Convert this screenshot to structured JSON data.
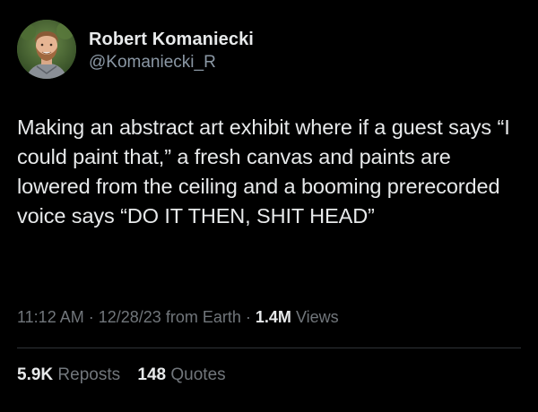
{
  "author": {
    "display_name": "Robert Komaniecki",
    "handle": "@Komaniecki_R"
  },
  "tweet": {
    "text": "Making an abstract art exhibit where if a guest says “I could paint that,” a fresh canvas and paints are lowered from the ceiling and a booming prerecorded voice says “DO IT THEN, SHIT HEAD”"
  },
  "meta": {
    "time": "11:12 AM",
    "separator": "·",
    "date": "12/28/23",
    "source": "from Earth",
    "views_count": "1.4M",
    "views_label": "Views"
  },
  "stats": {
    "reposts_count": "5.9K",
    "reposts_label": "Reposts",
    "quotes_count": "148",
    "quotes_label": "Quotes"
  },
  "icons": {
    "avatar": "profile-photo"
  },
  "colors": {
    "background": "#000000",
    "primary_text": "#e7e9ea",
    "secondary_text": "#71767b",
    "divider": "#2f3336"
  }
}
